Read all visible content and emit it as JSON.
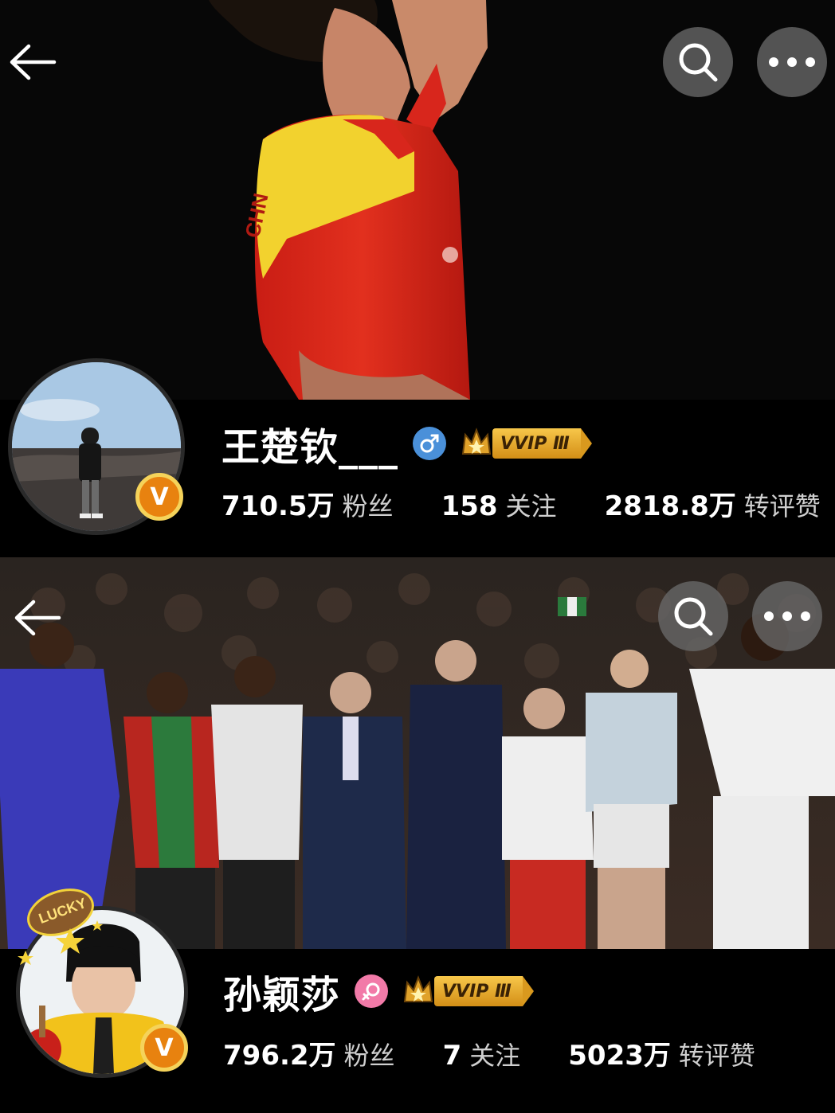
{
  "profiles": [
    {
      "name": "王楚钦___",
      "gender": "male",
      "vip_badge": "VVIP Ⅲ",
      "verified_mark": "V",
      "stats": [
        {
          "value": "710.5万",
          "label": "粉丝"
        },
        {
          "value": "158",
          "label": "关注"
        },
        {
          "value": "2818.8万",
          "label": "转评赞"
        }
      ],
      "jersey_text": "CHN"
    },
    {
      "name": "孙颖莎",
      "gender": "female",
      "vip_badge": "VVIP Ⅲ",
      "verified_mark": "V",
      "avatar_frame_text": "LUCKY",
      "stats": [
        {
          "value": "796.2万",
          "label": "粉丝"
        },
        {
          "value": "7",
          "label": "关注"
        },
        {
          "value": "5023万",
          "label": "转评赞"
        }
      ]
    }
  ],
  "icons": {
    "back": "back-arrow-icon",
    "search": "search-icon",
    "more": "more-dots-icon",
    "male": "male-icon",
    "female": "female-icon",
    "crown": "crown-icon"
  },
  "colors": {
    "background": "#000000",
    "male_badge": "#4a90d9",
    "female_badge": "#f27aa8",
    "vip_gold": "#e0a22a",
    "verified_orange": "#e8820f",
    "jersey_red": "#d8261c",
    "jersey_yellow": "#f2d22e"
  }
}
